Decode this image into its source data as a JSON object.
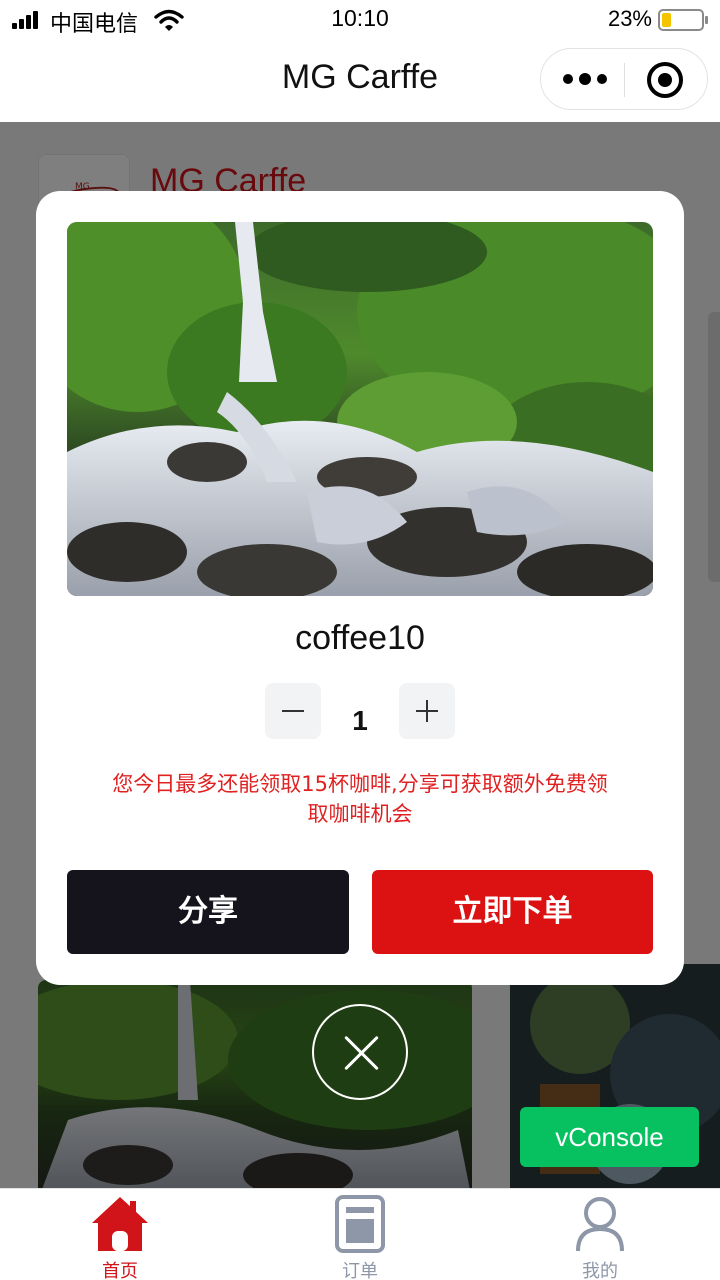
{
  "status_bar": {
    "carrier": "中国电信",
    "time": "10:10",
    "battery_percent": "23%",
    "battery_level": 0.23,
    "icons": [
      "signal-icon",
      "wifi-icon",
      "battery-icon"
    ]
  },
  "nav": {
    "title": "MG Carffe",
    "icons": [
      "more-icon",
      "close-mini-program-icon"
    ]
  },
  "shop": {
    "name": "MG Carffe",
    "logo_text": "MG"
  },
  "modal": {
    "product_name": "coffee10",
    "quantity": "1",
    "notice": "您今日最多还能领取15杯咖啡,分享可获取额外免费领取咖啡机会",
    "share_label": "分享",
    "order_label": "立即下单",
    "icons": [
      "minus-icon",
      "plus-icon",
      "close-icon"
    ]
  },
  "vconsole_label": "vConsole",
  "tabs": [
    {
      "label": "首页",
      "icon": "home-icon",
      "active": true
    },
    {
      "label": "订单",
      "icon": "order-icon",
      "active": false
    },
    {
      "label": "我的",
      "icon": "profile-icon",
      "active": false
    }
  ],
  "colors": {
    "accent": "#dc1212",
    "dark_button": "#15141c",
    "vconsole": "#07c160",
    "tab_active": "#d0141a",
    "tab_inactive": "#8e97a8"
  }
}
